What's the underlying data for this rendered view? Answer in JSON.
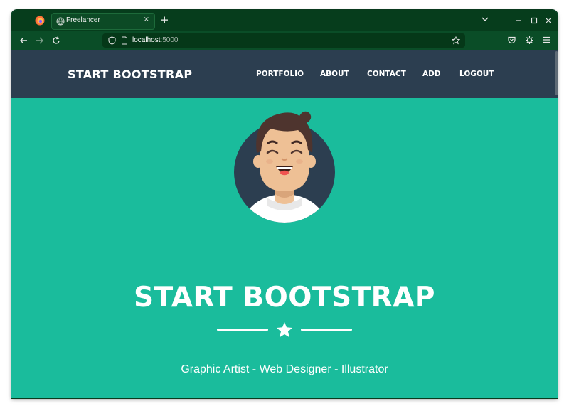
{
  "browser": {
    "tab_title": "Freelancer",
    "tab_close": "×",
    "new_tab": "+",
    "url_host": "localhost",
    "url_port": ":5000"
  },
  "site": {
    "brand": "START BOOTSTRAP",
    "nav": [
      "PORTFOLIO",
      "ABOUT",
      "CONTACT",
      "ADD",
      "LOGOUT"
    ]
  },
  "hero": {
    "title": "START BOOTSTRAP",
    "subtitle": "Graphic Artist - Web Designer - Illustrator"
  },
  "colors": {
    "primary": "#1abc9c",
    "navbar": "#2c3e50",
    "browser_chrome": "#063d1c"
  },
  "icons": [
    "firefox-icon",
    "back-arrow-icon",
    "forward-arrow-icon",
    "reload-icon",
    "shield-icon",
    "page-icon",
    "star-bookmark-icon",
    "pocket-icon",
    "extension-icon",
    "hamburger-menu-icon",
    "star-icon"
  ]
}
